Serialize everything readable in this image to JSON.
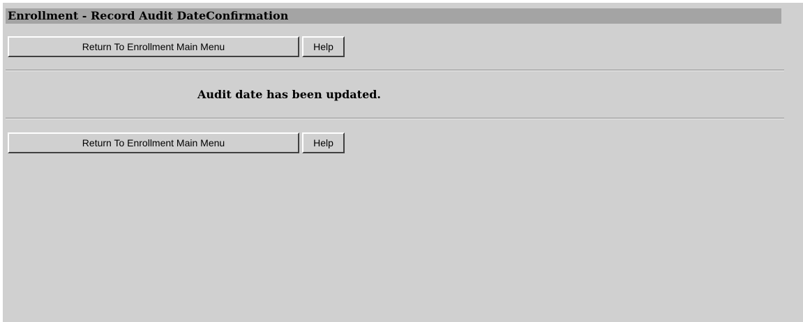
{
  "header": {
    "title": "Enrollment - Record Audit DateConfirmation"
  },
  "toolbar_top": {
    "return_label": "Return To Enrollment Main Menu",
    "help_label": "Help"
  },
  "message": {
    "text": "Audit date has been updated."
  },
  "toolbar_bottom": {
    "return_label": "Return To Enrollment Main Menu",
    "help_label": "Help"
  },
  "colors": {
    "page_background": "#d0d0d0",
    "title_bar": "#a4a4a4",
    "text": "#000000"
  }
}
